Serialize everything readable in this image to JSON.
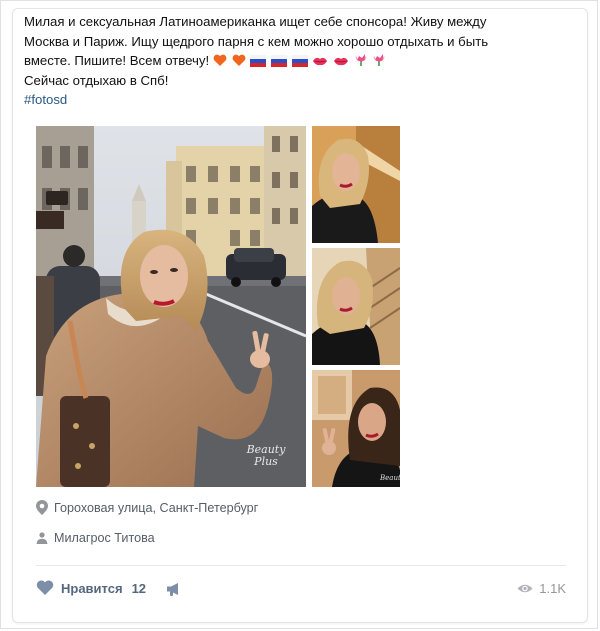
{
  "post": {
    "text_lines": [
      "Милая и сексуальная Латиноамериканка ищет себе спонсора! Живу между",
      "Москва и Париж. Ищу щедрого парня с кем можно хорошо отдыхать и быть",
      "вместе. Пишите! Всем отвечу!",
      "Сейчас отдыхаю в Спб!"
    ],
    "hashtag": "#fotosd",
    "emojis": [
      "heart-orange-icon",
      "heart-orange-icon",
      "flag-russia-icon",
      "flag-russia-icon",
      "flag-russia-icon",
      "kiss-lips-icon",
      "kiss-lips-icon",
      "tulip-icon",
      "tulip-icon"
    ]
  },
  "photos": {
    "main_watermark": "Beauty Plus",
    "small_watermark": "Beauty"
  },
  "location": {
    "text": "Гороховая улица, Санкт-Петербург",
    "icon": "location-pin-icon"
  },
  "author": {
    "text": "Милагрос Титова",
    "icon": "person-icon"
  },
  "actions": {
    "like_label": "Нравится",
    "like_count": "12",
    "views": "1.1K"
  },
  "colors": {
    "link": "#2a5885",
    "meta": "#555d66",
    "like": "#55677d",
    "heart_icon": "#7d8fa8",
    "views": "#939699"
  }
}
